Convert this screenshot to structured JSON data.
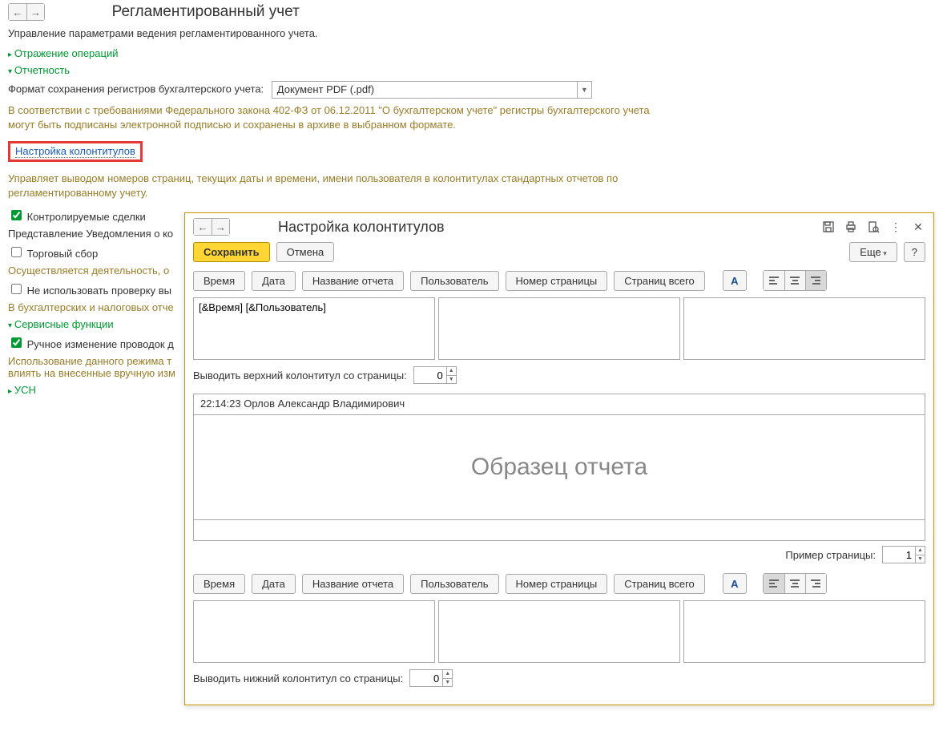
{
  "bg": {
    "title": "Регламентированный учет",
    "subtitle": "Управление параметрами ведения регламентированного учета.",
    "sec_ops": "Отражение операций",
    "sec_report": "Отчетность",
    "format_label": "Формат сохранения регистров бухгалтерского учета:",
    "format_value": "Документ PDF (.pdf)",
    "law_text": "В соответствии с требованиями Федерального закона 402-ФЗ от 06.12.2011 \"О бухгалтерском учете\" регистры бухгалтерского учета могут быть подписаны электронной подписью и сохранены в архиве в выбранном формате.",
    "headers_link": "Настройка колонтитулов",
    "headers_desc": "Управляет выводом номеров страниц, текущих даты и времени, имени пользователя в колонтитулах стандартных отчетов по регламентированному учету.",
    "chk_controlled": "Контролируемые сделки",
    "repr_note": "Представление Уведомления о ко",
    "chk_trade": "Торговый сбор",
    "activity_note": "Осуществляется деятельность, о",
    "chk_noverify": "Не использовать проверку вы",
    "tax_note": "В бухгалтерских и налоговых отче",
    "sec_service": "Сервисные функции",
    "chk_manual": "Ручное изменение проводок д",
    "manual_desc": "Использование данного режима т\nвлиять на внесенные вручную изм",
    "sec_usn": "УСН"
  },
  "dlg": {
    "title": "Настройка колонтитулов",
    "save": "Сохранить",
    "cancel": "Отмена",
    "more": "Еще",
    "help": "?",
    "tok_time": "Время",
    "tok_date": "Дата",
    "tok_report": "Название отчета",
    "tok_user": "Пользователь",
    "tok_page": "Номер страницы",
    "tok_total": "Страниц всего",
    "top_left_value": "[&Время] [&Пользователь]",
    "top_pager_label": "Выводить верхний колонтитул со страницы:",
    "top_pager_value": "0",
    "preview_header": "22:14:23 Орлов Александр Владимирович",
    "preview_body": "Образец отчета",
    "sample_label": "Пример страницы:",
    "sample_value": "1",
    "bot_pager_label": "Выводить нижний колонтитул со страницы:",
    "bot_pager_value": "0"
  }
}
